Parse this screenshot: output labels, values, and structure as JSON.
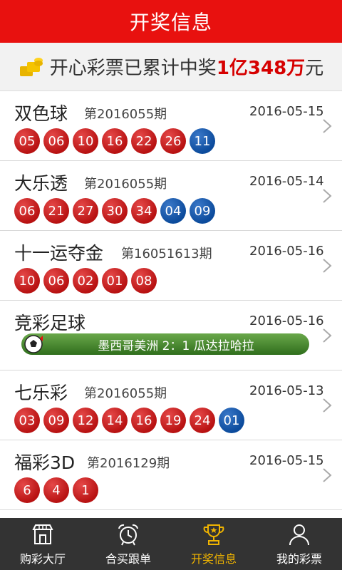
{
  "header": {
    "title": "开奖信息"
  },
  "banner": {
    "prefix": "开心彩票已累计中奖",
    "amount": "1亿348万",
    "suffix": "元"
  },
  "lotteries": [
    {
      "name": "双色球",
      "issue": "第2016055期",
      "date": "2016-05-15",
      "red": [
        "05",
        "06",
        "10",
        "16",
        "22",
        "26"
      ],
      "blue": [
        "11"
      ]
    },
    {
      "name": "大乐透",
      "issue": "第2016055期",
      "date": "2016-05-14",
      "red": [
        "06",
        "21",
        "27",
        "30",
        "34"
      ],
      "blue": [
        "04",
        "09"
      ]
    },
    {
      "name": "十一运夺金",
      "issue": "第16051613期",
      "date": "2016-05-16",
      "red": [
        "10",
        "06",
        "02",
        "01",
        "08"
      ],
      "blue": []
    },
    {
      "name": "竞彩足球",
      "issue": "",
      "date": "2016-05-16",
      "match": "墨西哥美洲 2：1 瓜达拉哈拉"
    },
    {
      "name": "七乐彩",
      "issue": "第2016055期",
      "date": "2016-05-13",
      "red": [
        "03",
        "09",
        "12",
        "14",
        "16",
        "19",
        "24"
      ],
      "blue": [
        "01"
      ]
    },
    {
      "name": "福彩3D",
      "issue": "第2016129期",
      "date": "2016-05-15",
      "red": [
        "6",
        "4",
        "1"
      ],
      "blue": []
    }
  ],
  "tabs": [
    {
      "label": "购彩大厅",
      "icon": "store-icon",
      "active": false
    },
    {
      "label": "合买跟单",
      "icon": "alarm-clock-icon",
      "active": false
    },
    {
      "label": "开奖信息",
      "icon": "trophy-icon",
      "active": true
    },
    {
      "label": "我的彩票",
      "icon": "user-icon",
      "active": false
    }
  ],
  "colors": {
    "header": "#e8110f",
    "red_ball": "#c41a1a",
    "blue_ball": "#0c4b9c",
    "tab_active": "#f0b400",
    "tabbar": "#333333"
  }
}
